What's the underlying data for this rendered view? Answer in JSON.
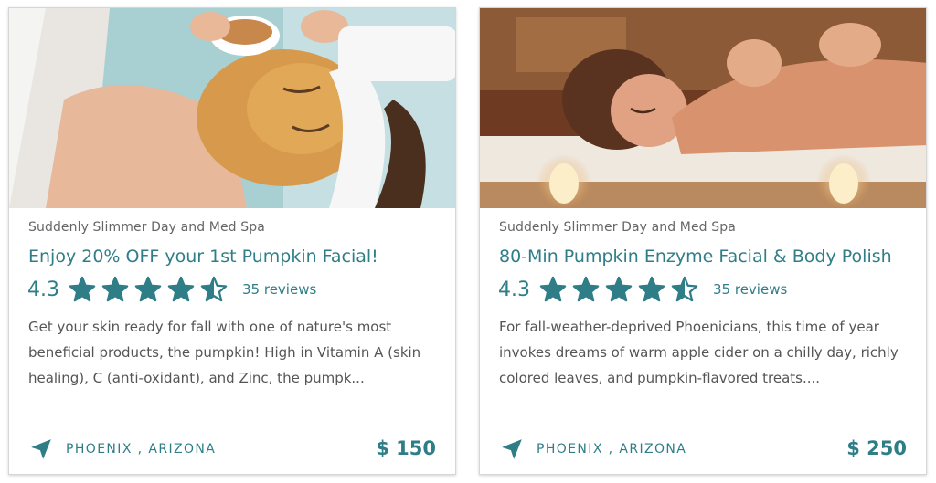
{
  "accent": "#2f7e87",
  "cards": [
    {
      "vendor": "Suddenly Slimmer Day and Med Spa",
      "title": "Enjoy 20% OFF your 1st Pumpkin Facial!",
      "rating": "4.3",
      "rating_value": 4.3,
      "reviews": "35 reviews",
      "description": "Get your skin ready for fall with one of nature's most beneficial products, the pumpkin! High in Vitamin A (skin healing), C (anti-oxidant), and Zinc, the pumpk...",
      "location": "PHOENIX , ARIZONA",
      "price": "$ 150",
      "image_icon": "facial-mask-photo"
    },
    {
      "vendor": "Suddenly Slimmer Day and Med Spa",
      "title": "80-Min Pumpkin Enzyme Facial & Body Polish",
      "rating": "4.3",
      "rating_value": 4.3,
      "reviews": "35 reviews",
      "description": "For fall-weather-deprived Phoenicians, this time of year invokes dreams of warm apple cider on a chilly day, richly colored leaves, and pumpkin-flavored treats....",
      "location": "PHOENIX , ARIZONA",
      "price": "$ 250",
      "image_icon": "massage-photo"
    }
  ]
}
